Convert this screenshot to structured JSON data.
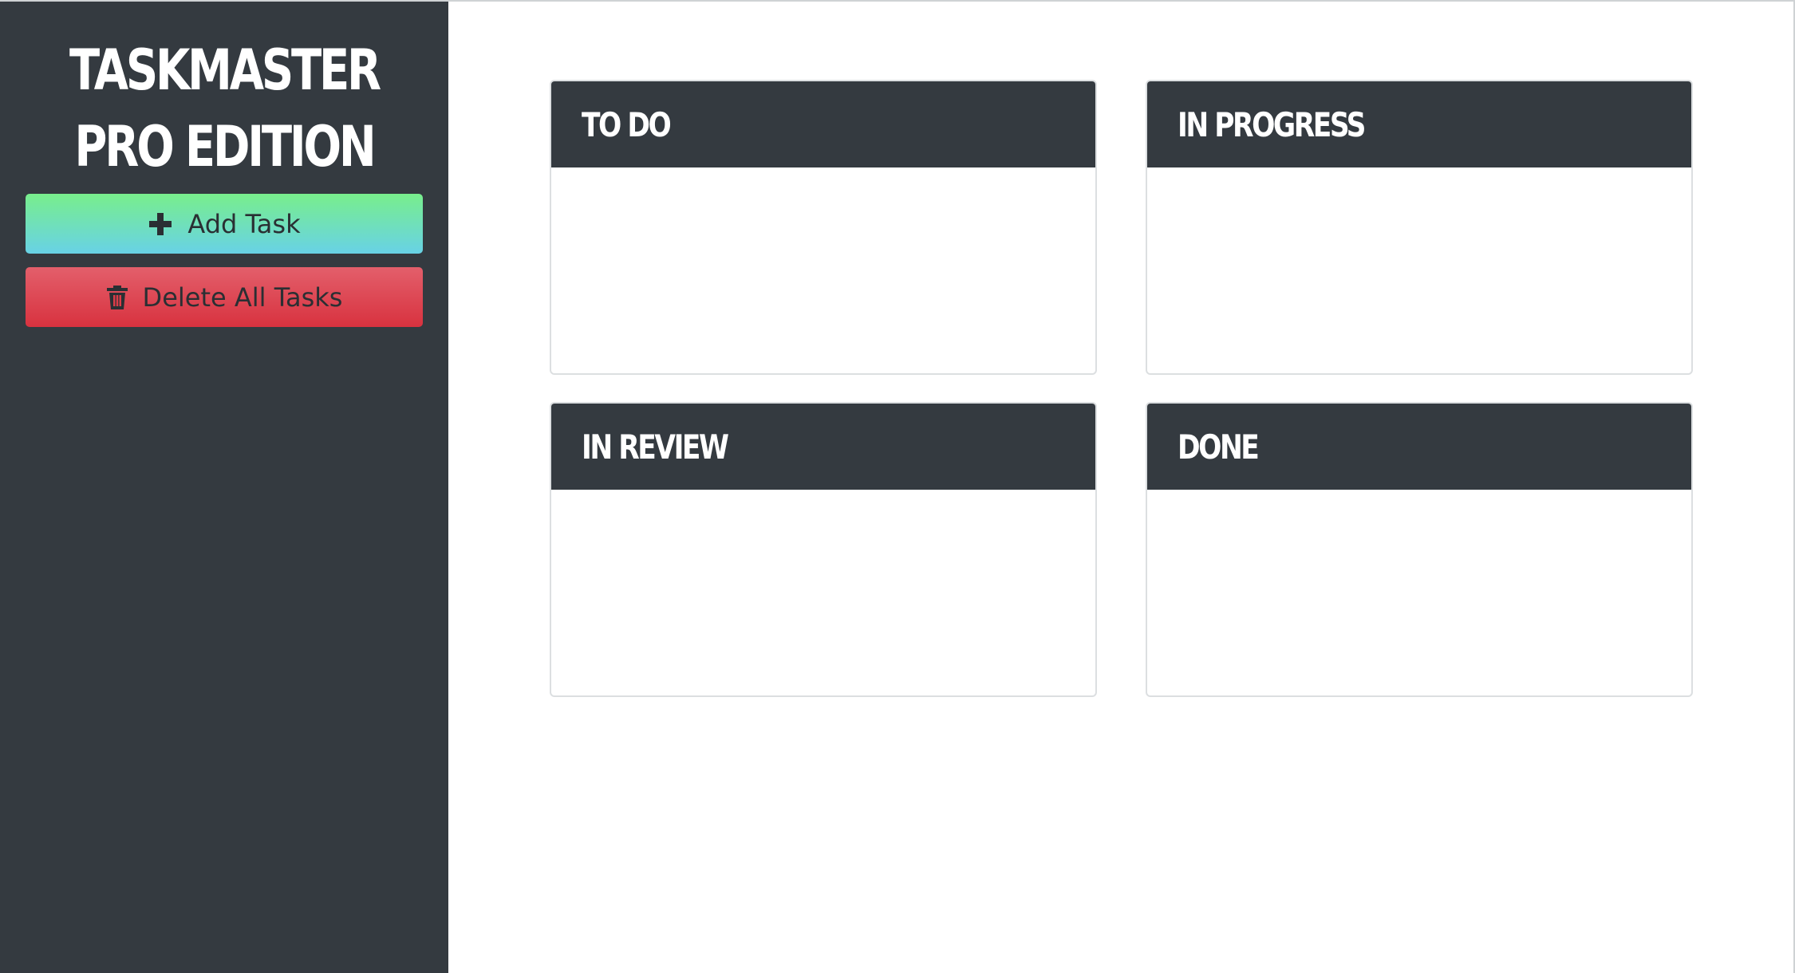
{
  "sidebar": {
    "title": "TASKMASTER PRO EDITION",
    "add_button": {
      "label": "Add Task",
      "icon": "plus-icon"
    },
    "delete_button": {
      "label": "Delete All Tasks",
      "icon": "trash-icon"
    }
  },
  "board": {
    "columns": [
      {
        "title": "TO DO"
      },
      {
        "title": "IN PROGRESS"
      },
      {
        "title": "IN REVIEW"
      },
      {
        "title": "DONE"
      }
    ]
  },
  "colors": {
    "sidebar_bg": "#343a40",
    "column_header_bg": "#343a40",
    "add_gradient_top": "#78ee8c",
    "add_gradient_bottom": "#68d2e6",
    "delete_gradient_top": "#e35f6b",
    "delete_gradient_bottom": "#d8323f"
  }
}
